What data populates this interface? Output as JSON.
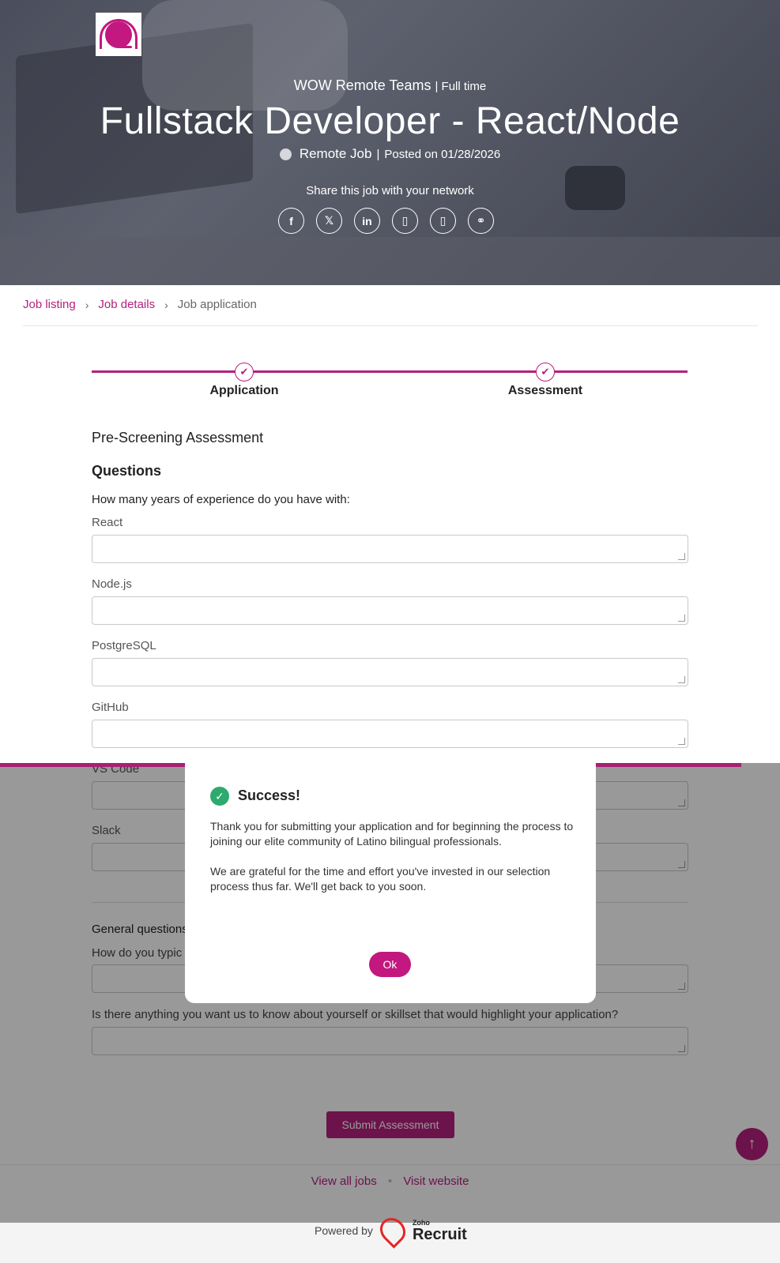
{
  "header": {
    "company": "WOW Remote Teams",
    "employment_type": "Full time",
    "job_title": "Fullstack Developer - React/Node",
    "location": "Remote Job",
    "posted": "Posted on 01/28/2026",
    "share_label": "Share this job with your network",
    "share_icons": [
      "facebook-icon",
      "x-icon",
      "linkedin-icon",
      "share-icon-4",
      "share-icon-5",
      "link-icon"
    ]
  },
  "breadcrumb": {
    "items": [
      "Job listing",
      "Job details",
      "Job application"
    ]
  },
  "stepper": {
    "steps": [
      "Application",
      "Assessment"
    ]
  },
  "form": {
    "heading": "Pre-Screening Assessment",
    "subheading": "Questions",
    "question": "How many years of experience do you have with:",
    "fields": [
      "React",
      "Node.js",
      "PostgreSQL",
      "GitHub",
      "VS Code",
      "Slack"
    ],
    "general_heading": "General questions",
    "general_q1": "How do you typic",
    "general_q2": "Is there anything you want us to know about yourself or skillset that would highlight your application?",
    "submit_label": "Submit Assessment"
  },
  "footer": {
    "view_all": "View all jobs",
    "visit": "Visit website",
    "powered_by": "Powered by",
    "brand_small": "Zoho",
    "brand": "Recruit"
  },
  "modal": {
    "title": "Success!",
    "message1": "Thank you  for submitting your application and for beginning the process to joining our elite community of Latino bilingual professionals.",
    "message2": "We are grateful for the time and effort you've invested in our selection process thus far. We'll get back to you soon.",
    "ok_label": "Ok"
  },
  "colors": {
    "accent": "#b5207d",
    "success": "#2eaa6e"
  }
}
